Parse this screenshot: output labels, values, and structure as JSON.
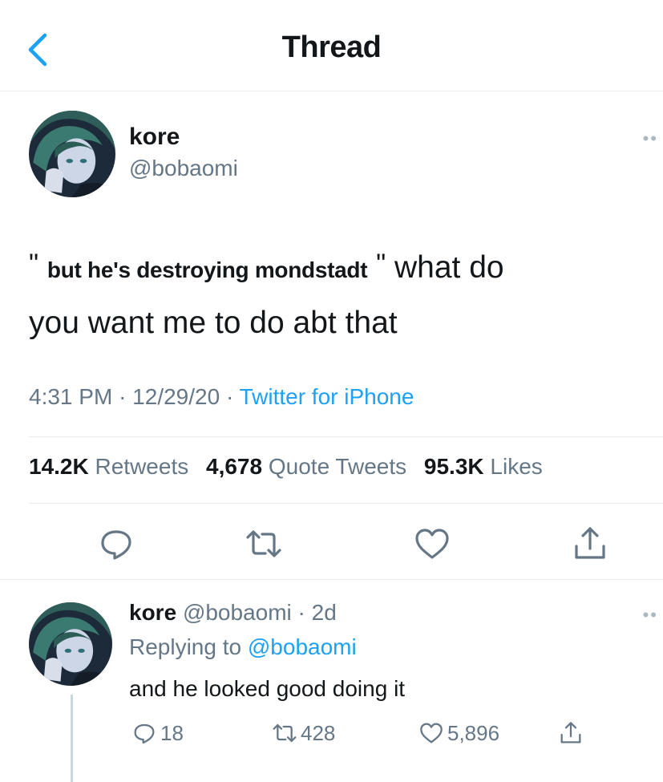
{
  "header": {
    "title": "Thread"
  },
  "tweet": {
    "name": "kore",
    "handle": "@bobaomi",
    "text": {
      "open_quote": "\"",
      "quoted": "but he's destroying mondstadt",
      "close_quote": "\"",
      "rest_line1": " what do",
      "rest_line2": "you want me to do abt that"
    },
    "time": "4:31 PM",
    "date": "12/29/20",
    "source": "Twitter for iPhone",
    "stats": {
      "retweets_count": "14.2K",
      "retweets_label": "Retweets",
      "quotes_count": "4,678",
      "quotes_label": "Quote Tweets",
      "likes_count": "95.3K",
      "likes_label": "Likes"
    }
  },
  "reply": {
    "name": "kore",
    "handle_time": "@bobaomi · 2d",
    "replying_prefix": "Replying to",
    "replying_mention": "@bobaomi",
    "text": "and he looked good doing it",
    "reply_count": "18",
    "retweet_count": "428",
    "like_count": "5,896"
  },
  "icons": {
    "back": "chevron-left-icon",
    "reply": "speech-bubble-icon",
    "retweet": "retweet-arrows-icon",
    "like": "heart-icon",
    "share": "share-upload-icon"
  },
  "colors": {
    "accent": "#1da1f2",
    "secondary_text": "#657786",
    "primary_text": "#14171a",
    "divider": "#e6ecf0"
  }
}
